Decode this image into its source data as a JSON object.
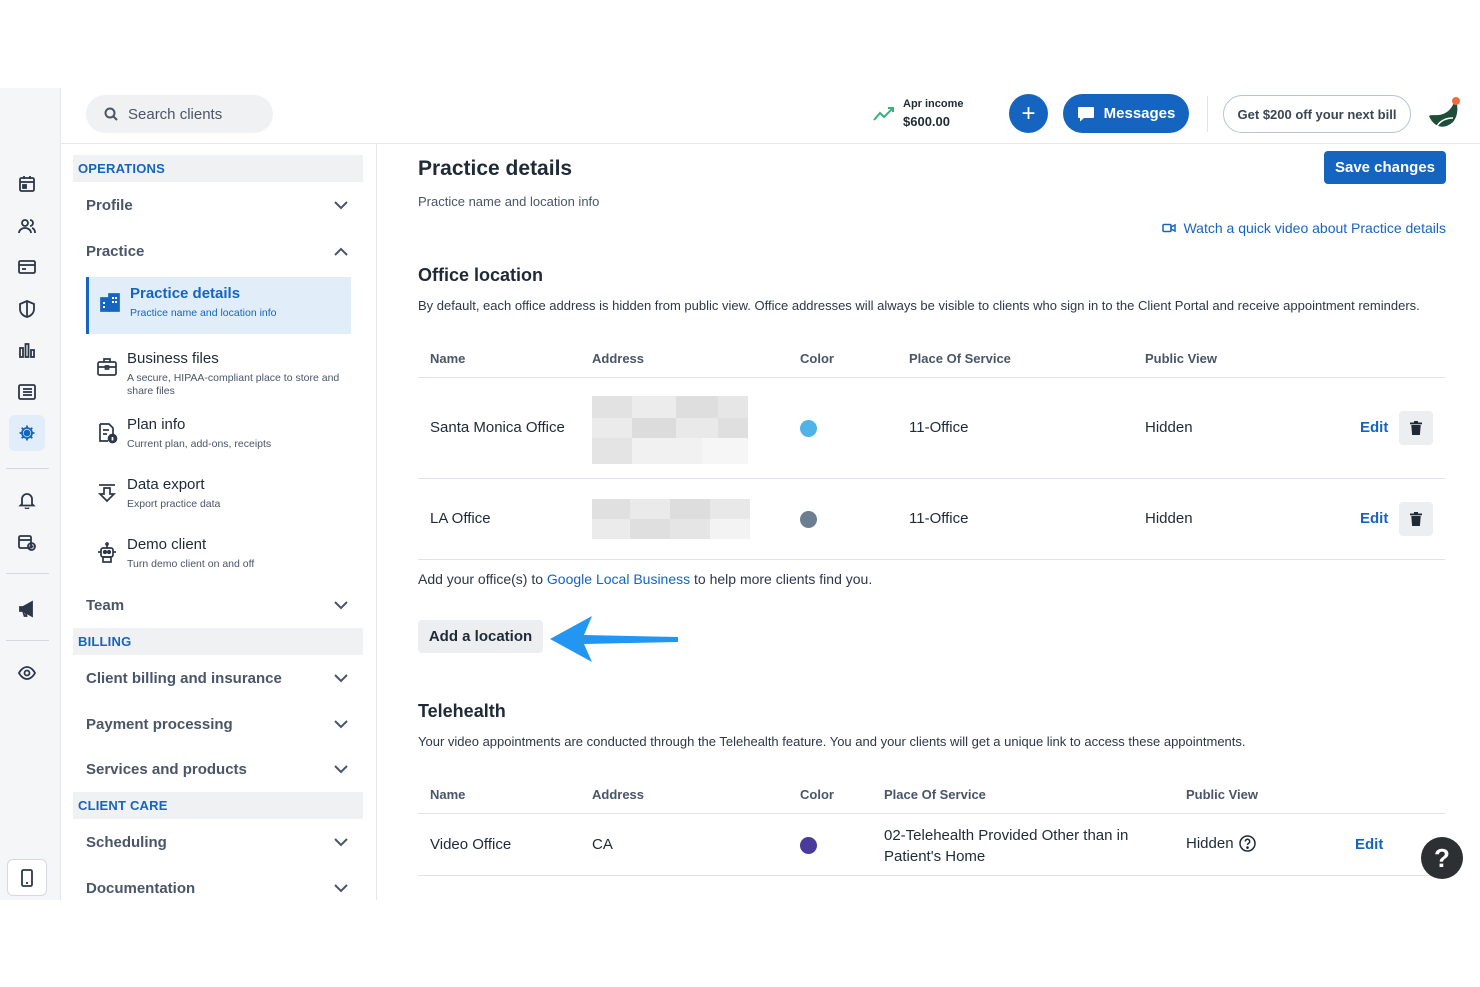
{
  "search": {
    "placeholder": "Search clients"
  },
  "topbar": {
    "income_label": "Apr income",
    "income_value": "$600.00",
    "plus_label": "+",
    "messages_label": "Messages",
    "promo_label": "Get $200 off your next bill"
  },
  "settings_nav": {
    "sections": {
      "operations": "OPERATIONS",
      "billing": "BILLING",
      "client_care": "CLIENT CARE"
    },
    "groups": {
      "profile": "Profile",
      "practice": "Practice",
      "team": "Team",
      "client_billing": "Client billing and insurance",
      "payment_processing": "Payment processing",
      "services_products": "Services and products",
      "scheduling": "Scheduling",
      "documentation": "Documentation"
    },
    "practice_items": [
      {
        "title": "Practice details",
        "desc": "Practice name and location info"
      },
      {
        "title": "Business files",
        "desc": "A secure, HIPAA-compliant place to store and share files"
      },
      {
        "title": "Plan info",
        "desc": "Current plan, add-ons, receipts"
      },
      {
        "title": "Data export",
        "desc": "Export practice data"
      },
      {
        "title": "Demo client",
        "desc": "Turn demo client on and off"
      }
    ]
  },
  "main": {
    "title": "Practice details",
    "subtitle": "Practice name and location info",
    "save_label": "Save changes",
    "video_link": "Watch a quick video about Practice details",
    "office": {
      "heading": "Office location",
      "description": "By default, each office address is hidden from public view. Office addresses will always be visible to clients who sign in to the Client Portal and receive appointment reminders.",
      "columns": [
        "Name",
        "Address",
        "Color",
        "Place Of Service",
        "Public View"
      ],
      "rows": [
        {
          "name": "Santa Monica Office",
          "color": "#4fb3e8",
          "pos": "11-Office",
          "public": "Hidden",
          "edit": "Edit"
        },
        {
          "name": "LA Office",
          "color": "#6b7f91",
          "pos": "11-Office",
          "public": "Hidden",
          "edit": "Edit"
        }
      ],
      "google_prefix": "Add your office(s) to ",
      "google_link": "Google Local Business",
      "google_suffix": " to help more clients find you.",
      "add_location_label": "Add a location"
    },
    "telehealth": {
      "heading": "Telehealth",
      "description": "Your video appointments are conducted through the Telehealth feature. You and your clients will get a unique link to access these appointments.",
      "columns": [
        "Name",
        "Address",
        "Color",
        "Place Of Service",
        "Public View"
      ],
      "rows": [
        {
          "name": "Video Office",
          "address": "CA",
          "color": "#4a3a9a",
          "pos": "02-Telehealth Provided Other than in Patient's Home",
          "public": "Hidden",
          "edit": "Edit"
        }
      ]
    }
  },
  "help": {
    "label": "?"
  },
  "colors": {
    "accent": "#1565c0",
    "arrow": "#2196f3",
    "income_trend": "#38b27a"
  }
}
